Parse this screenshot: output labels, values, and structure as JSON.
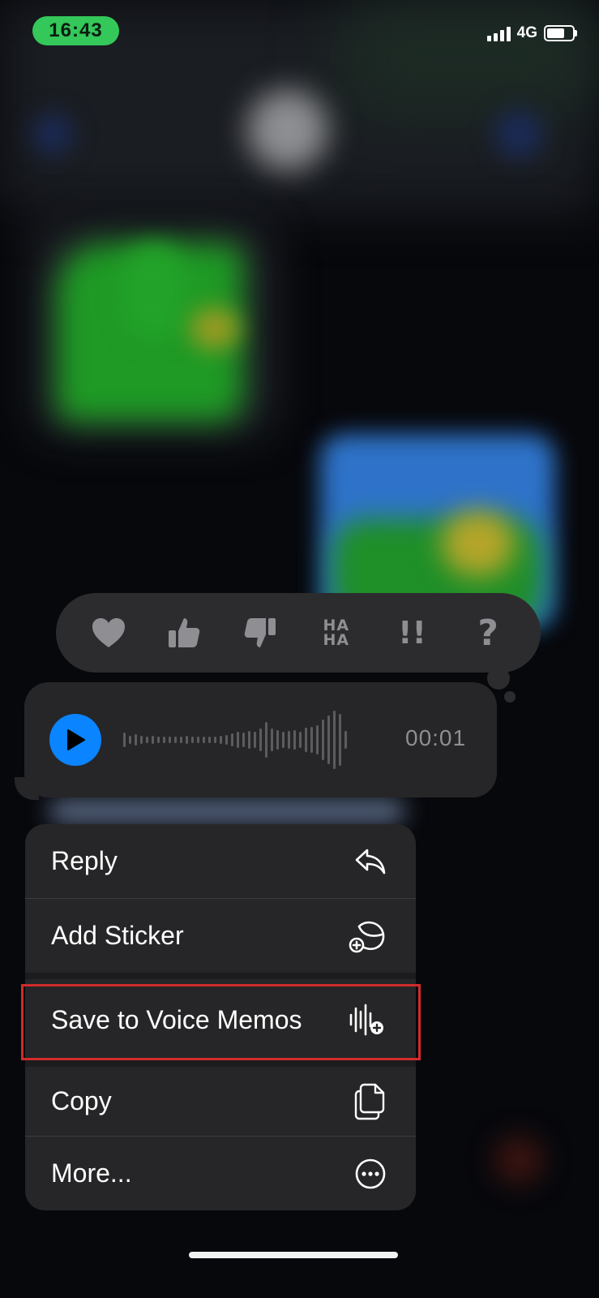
{
  "status_bar": {
    "time": "16:43",
    "network": "4G",
    "battery_level": 0.8
  },
  "reactions": [
    {
      "name": "heart-icon"
    },
    {
      "name": "thumbs-up-icon"
    },
    {
      "name": "thumbs-down-icon"
    },
    {
      "name": "haha-icon",
      "line1": "HA",
      "line2": "HA"
    },
    {
      "name": "exclamation-icon",
      "text": "!!"
    },
    {
      "name": "question-icon",
      "text": "?"
    }
  ],
  "voice_message": {
    "duration": "00:01"
  },
  "menu": {
    "items": [
      {
        "label": "Reply",
        "icon": "reply-icon"
      },
      {
        "label": "Add Sticker",
        "icon": "sticker-icon"
      },
      {
        "label": "Save to Voice Memos",
        "icon": "voice-memo-add-icon",
        "highlighted": true
      },
      {
        "label": "Copy",
        "icon": "copy-icon"
      },
      {
        "label": "More...",
        "icon": "ellipsis-circle-icon"
      }
    ]
  },
  "colors": {
    "accent": "#0a84ff",
    "highlight_border": "#d22b2b",
    "time_pill": "#34c759"
  }
}
